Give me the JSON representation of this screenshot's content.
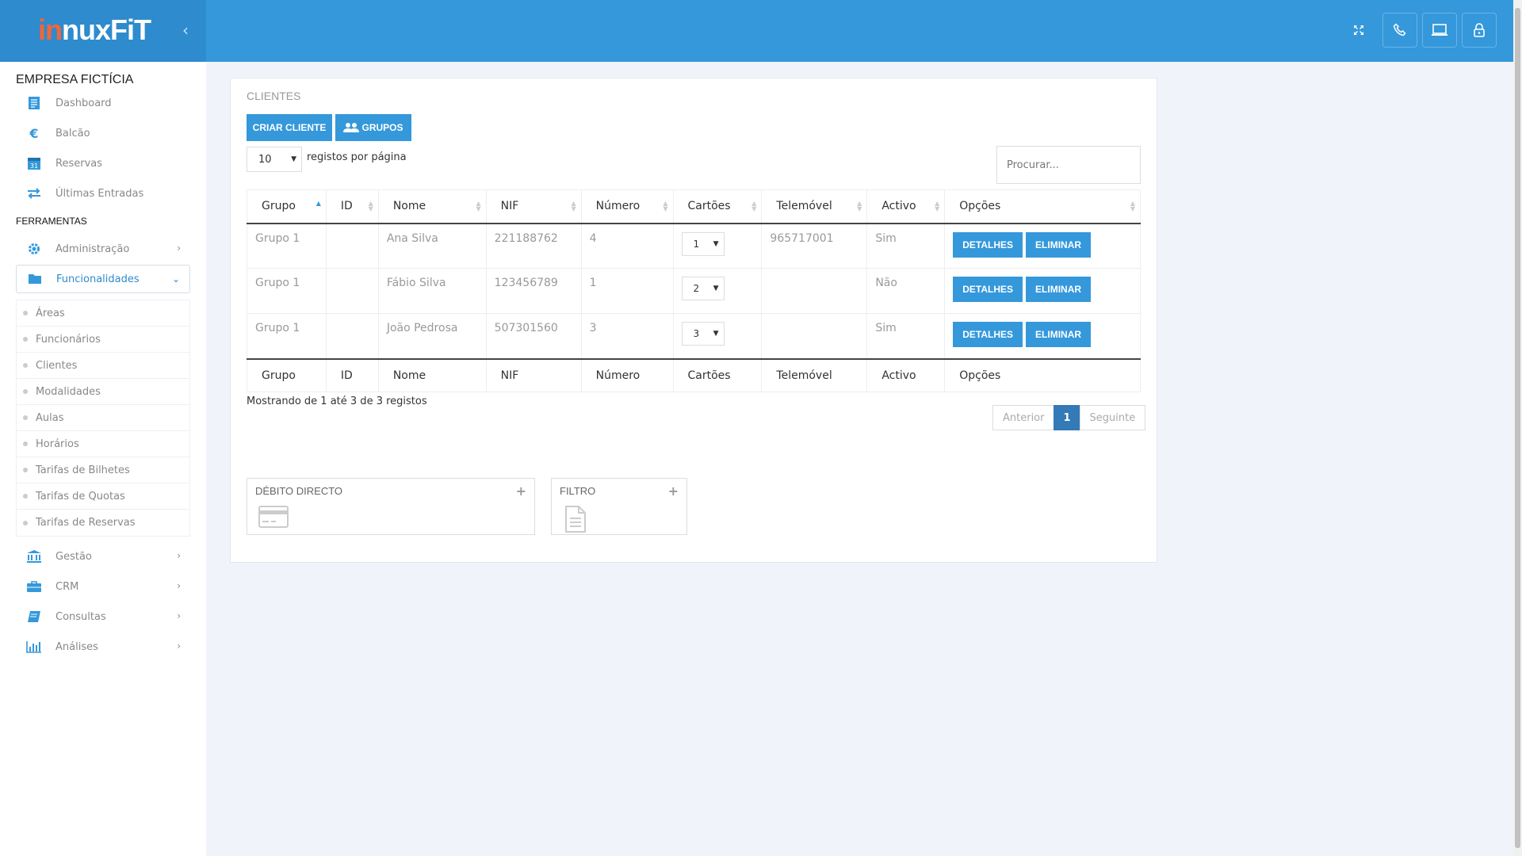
{
  "header": {
    "logo_in": "in",
    "logo_rest": "nuxFiT",
    "collapse_glyph": "‹",
    "icons": [
      "expand-icon",
      "phone-icon",
      "laptop-icon",
      "lock-icon"
    ]
  },
  "sidebar": {
    "company": "EMPRESA FICTÍCIA",
    "top_items": [
      {
        "label": "Dashboard",
        "icon": "dashboard-icon"
      },
      {
        "label": "Balcão",
        "icon": "euro-icon"
      },
      {
        "label": "Reservas",
        "icon": "calendar-icon"
      },
      {
        "label": "Últimas Entradas",
        "icon": "exchange-icon"
      }
    ],
    "tools_title": "FERRAMENTAS",
    "administracao": "Administração",
    "funcionalidades": "Funcionalidades",
    "sub_items": [
      "Áreas",
      "Funcionários",
      "Clientes",
      "Modalidades",
      "Aulas",
      "Horários",
      "Tarifas de Bilhetes",
      "Tarifas de Quotas",
      "Tarifas de Reservas"
    ],
    "bottom_items": [
      {
        "label": "Gestão",
        "icon": "bank-icon"
      },
      {
        "label": "CRM",
        "icon": "briefcase-icon"
      },
      {
        "label": "Consultas",
        "icon": "book-icon"
      },
      {
        "label": "Análises",
        "icon": "bar-chart-icon"
      }
    ]
  },
  "main": {
    "title": "CLIENTES",
    "create_button": "CRIAR CLIENTE",
    "groups_button": "GRUPOS",
    "page_size": "10",
    "per_page_label": "registos por página",
    "search_placeholder": "Procurar...",
    "columns": [
      "Grupo",
      "ID",
      "Nome",
      "NIF",
      "Número",
      "Cartões",
      "Telemóvel",
      "Activo",
      "Opções"
    ],
    "rows": [
      {
        "grupo": "Grupo 1",
        "id": "",
        "nome": "Ana Silva",
        "nif": "221188762",
        "numero": "4",
        "cartoes": "1",
        "telemovel": "965717001",
        "activo": "Sim"
      },
      {
        "grupo": "Grupo 1",
        "id": "",
        "nome": "Fábio Silva",
        "nif": "123456789",
        "numero": "1",
        "cartoes": "2",
        "telemovel": "",
        "activo": "Não"
      },
      {
        "grupo": "Grupo 1",
        "id": "",
        "nome": "João Pedrosa",
        "nif": "507301560",
        "numero": "3",
        "cartoes": "3",
        "telemovel": "",
        "activo": "Sim"
      }
    ],
    "details_label": "DETALHES",
    "delete_label": "ELIMINAR",
    "info": "Mostrando de 1 até 3 de 3 registos",
    "pager": {
      "prev": "Anterior",
      "current": "1",
      "next": "Seguinte"
    },
    "widgets": [
      {
        "title": "DÉBITO DIRECTO",
        "icon": "credit-card-icon"
      },
      {
        "title": "FILTRO",
        "icon": "document-icon"
      }
    ]
  },
  "colors": {
    "primary": "#3498db",
    "header_dark": "#2e8bcd",
    "logo_accent": "#f2653a"
  }
}
